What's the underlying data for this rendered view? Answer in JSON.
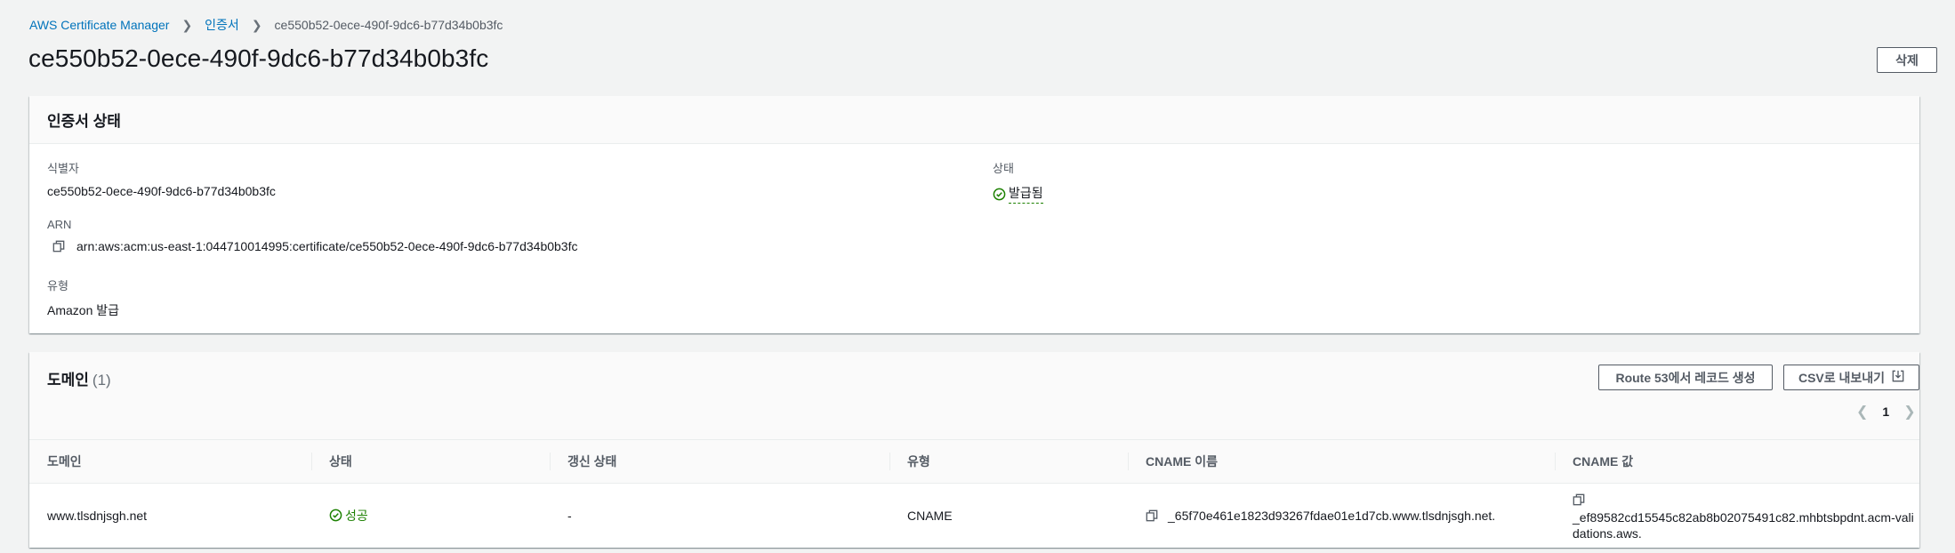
{
  "breadcrumb": {
    "root": "AWS Certificate Manager",
    "parent": "인증서",
    "current": "ce550b52-0ece-490f-9dc6-b77d34b0b3fc"
  },
  "page": {
    "title": "ce550b52-0ece-490f-9dc6-b77d34b0b3fc",
    "delete_label": "삭제"
  },
  "status_panel": {
    "title": "인증서 상태",
    "identifier_label": "식별자",
    "identifier_value": "ce550b52-0ece-490f-9dc6-b77d34b0b3fc",
    "arn_label": "ARN",
    "arn_value": "arn:aws:acm:us-east-1:044710014995:certificate/ce550b52-0ece-490f-9dc6-b77d34b0b3fc",
    "type_label": "유형",
    "type_value": "Amazon 발급",
    "status_label": "상태",
    "status_value": "발급됨"
  },
  "domain_panel": {
    "title": "도메인",
    "count": "(1)",
    "route53_label": "Route 53에서 레코드 생성",
    "csv_label": "CSV로 내보내기",
    "page_number": "1",
    "columns": [
      "도메인",
      "상태",
      "갱신 상태",
      "유형",
      "CNAME 이름",
      "CNAME 값"
    ],
    "rows": [
      {
        "domain": "www.tlsdnjsgh.net",
        "status": "성공",
        "renewal_status": "-",
        "type": "CNAME",
        "cname_name": "_65f70e461e1823d93267fdae01e1d7cb.www.tlsdnjsgh.net.",
        "cname_value": "_ef89582cd15545c82ab8b02075491c82.mhbtsbpdnt.acm-validations.aws."
      }
    ]
  },
  "colors": {
    "link": "#0073bb",
    "success": "#1d8102",
    "background": "#f2f3f3"
  },
  "icons": [
    "chevron-right-icon",
    "copy-icon",
    "check-circle-icon",
    "download-icon",
    "chevron-left-icon"
  ]
}
